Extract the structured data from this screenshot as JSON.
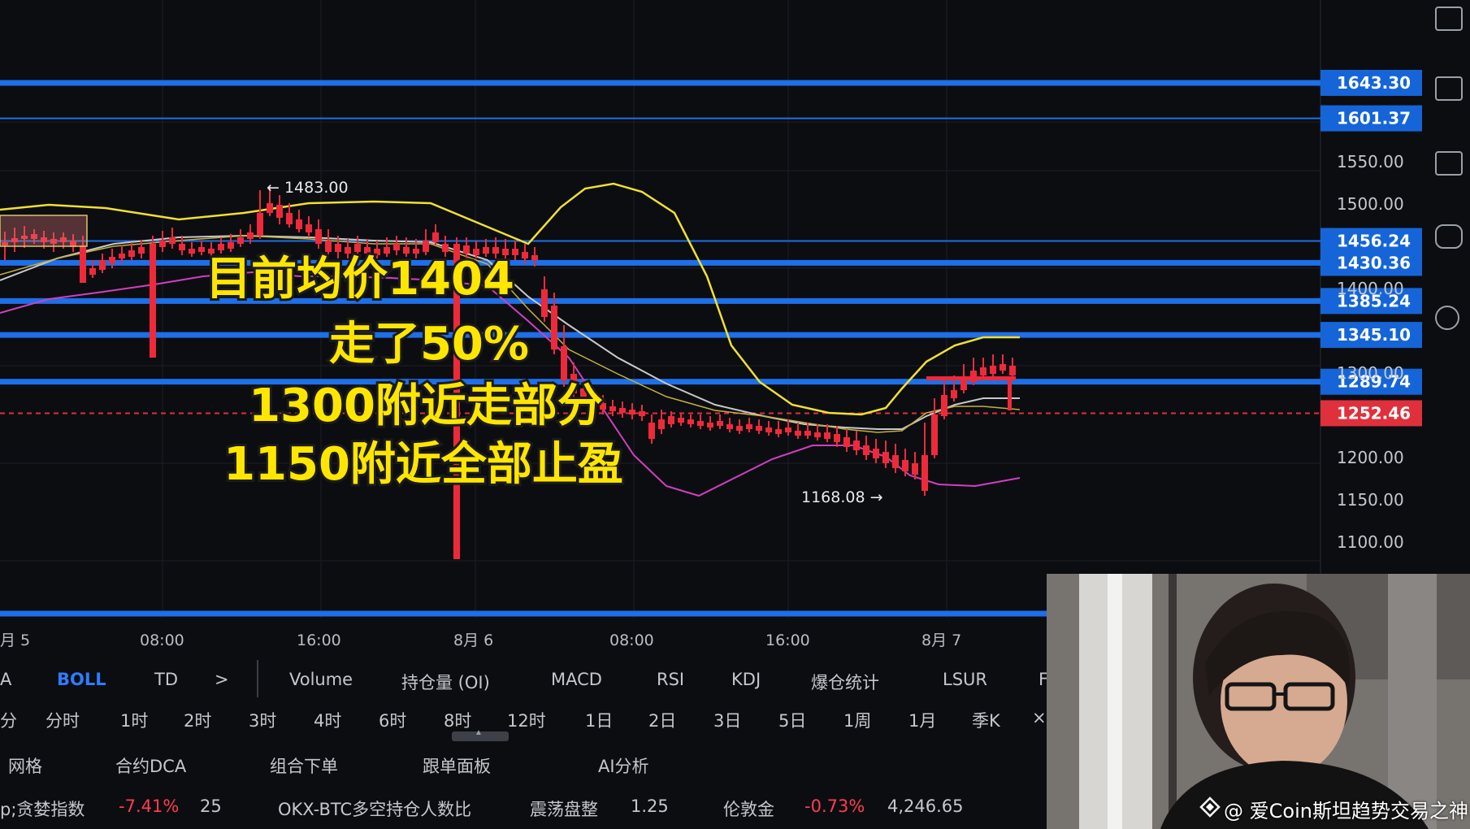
{
  "chart": {
    "price_scale": [
      "1550.00",
      "1500.00",
      "1400.00",
      "1300.00",
      "1200.00",
      "1150.00",
      "1100.00"
    ],
    "levels": [
      {
        "label": "1643.30",
        "price": 1643.3,
        "thick": true
      },
      {
        "label": "1601.37",
        "price": 1601.37,
        "thick": false
      },
      {
        "label": "1456.24",
        "price": 1456.24,
        "thick": false
      },
      {
        "label": "1430.36",
        "price": 1430.36,
        "thick": true
      },
      {
        "label": "1385.24",
        "price": 1385.24,
        "thick": true
      },
      {
        "label": "1345.10",
        "price": 1345.1,
        "thick": true
      },
      {
        "label": "1289.74",
        "price": 1289.74,
        "thick": true
      }
    ],
    "current_price": "1252.46",
    "high_label": "← 1483.00",
    "low_label": "1168.08 →",
    "time_labels": [
      "月 5",
      "08:00",
      "16:00",
      "8月 6",
      "08:00",
      "16:00",
      "8月 7"
    ],
    "overlay_text": [
      "目前均价1404",
      "走了50%",
      "1300附近走部分",
      "1150附近全部止盈"
    ],
    "colors": {
      "level_line": "#1e6fe8",
      "level_box": "#1565d8",
      "current_box": "#e0303c",
      "up_candle": "#1faa5a",
      "down_candle": "#ee2a3a",
      "boll_upper": "#f0e030",
      "boll_mid": "#c8c8c8",
      "boll_lower": "#d040c0",
      "overlay_text": "#ffe600"
    }
  },
  "indicators": {
    "items": [
      "A",
      "BOLL",
      "TD",
      ">",
      "Volume",
      "持仓量 (OI)",
      "MACD",
      "RSI",
      "KDJ",
      "爆仓统计",
      "LSUR",
      "F"
    ],
    "active": "BOLL"
  },
  "timeframes": [
    "分",
    "分时",
    "1时",
    "2时",
    "3时",
    "4时",
    "6时",
    "8时",
    "12时",
    "1日",
    "2日",
    "3日",
    "5日",
    "1周",
    "1月",
    "季K",
    "×"
  ],
  "tools": [
    "网格",
    "合约DCA",
    "组合下单",
    "跟单面板",
    "AI分析"
  ],
  "ticker": {
    "fear_label": "p;贪婪指数",
    "fear_change": "-7.41%",
    "fear_value": "25",
    "btc_label": "OKX-BTC多空持仓人数比",
    "btc_state": "震荡盘整",
    "btc_value": "1.25",
    "gold_label": "伦敦金",
    "gold_change": "-0.73%",
    "gold_value": "4,246.65"
  },
  "watermark": "@ 爱Coin斯坦趋势交易之神",
  "icons": [
    "chart-settings-icon",
    "indicator-icon",
    "etf-icon",
    "robot-icon",
    "gear-icon",
    "watermark-logo-icon"
  ]
}
